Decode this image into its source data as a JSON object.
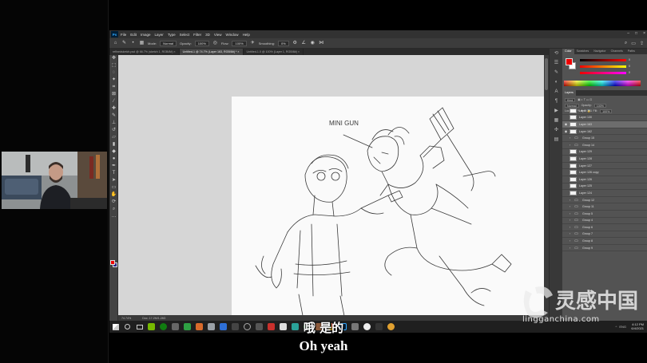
{
  "menu": [
    "File",
    "Edit",
    "Image",
    "Layer",
    "Type",
    "Select",
    "Filter",
    "3D",
    "View",
    "Window",
    "Help"
  ],
  "options": {
    "mode_label": "Mode:",
    "mode_value": "Normal",
    "opacity_label": "Opacity:",
    "opacity_value": "100%",
    "flow_label": "Flow:",
    "flow_value": "100%",
    "smoothing_label": "Smoothing:",
    "smoothing_value": "0%"
  },
  "tabs": [
    {
      "label": "refinedsketch.psd @ 66.7% (sketch 1, RGB/8#) ×",
      "active": false
    },
    {
      "label": "Untitled-1 @ 74.7% (Layer 163, RGB/8#) * ×",
      "active": true
    },
    {
      "label": "Untitled-1.0 @ 100% (Layer 1, RGB/8#) ×",
      "active": false
    }
  ],
  "canvas": {
    "sketch_text": "MINI GUN",
    "status_zoom": "74.74%",
    "status_doc": "Doc: 17.2M/1.28G"
  },
  "color_panel": {
    "tabs": [
      "Color",
      "Swatches",
      "Navigator",
      "Channels",
      "Paths"
    ],
    "values": [
      "0",
      "0",
      "0"
    ],
    "fg": "#ee0000",
    "bg": "#ffffff"
  },
  "layers_panel": {
    "tabs": [
      "Layers"
    ],
    "kind_label": "Kind",
    "blend_mode": "Normal",
    "opacity_label": "Opacity:",
    "opacity_value": "100%",
    "lock_label": "Lock:",
    "fill_label": "Fill:",
    "fill_value": "100%",
    "items": [
      {
        "name": "Layer 161",
        "type": "layer",
        "visible": false,
        "selected": false
      },
      {
        "name": "Layer 130",
        "type": "layer",
        "visible": false,
        "selected": false
      },
      {
        "name": "Layer 163",
        "type": "layer",
        "visible": true,
        "selected": true
      },
      {
        "name": "Layer 162",
        "type": "layer",
        "visible": true,
        "selected": false
      },
      {
        "name": "Group 15",
        "type": "group",
        "visible": false,
        "selected": false
      },
      {
        "name": "Group 14",
        "type": "group",
        "visible": false,
        "selected": false
      },
      {
        "name": "Layer 129",
        "type": "layer",
        "visible": false,
        "selected": false
      },
      {
        "name": "Layer 128",
        "type": "layer",
        "visible": false,
        "selected": false
      },
      {
        "name": "Layer 127",
        "type": "layer",
        "visible": false,
        "selected": false
      },
      {
        "name": "Layer 126 copy",
        "type": "layer",
        "visible": false,
        "selected": false
      },
      {
        "name": "Layer 126",
        "type": "layer",
        "visible": false,
        "selected": false
      },
      {
        "name": "Layer 125",
        "type": "layer",
        "visible": false,
        "selected": false
      },
      {
        "name": "Layer 124",
        "type": "layer",
        "visible": false,
        "selected": false
      },
      {
        "name": "Group 12",
        "type": "group",
        "visible": false,
        "selected": false
      },
      {
        "name": "Group 11",
        "type": "group",
        "visible": false,
        "selected": false
      },
      {
        "name": "Group 5",
        "type": "group",
        "visible": false,
        "selected": false
      },
      {
        "name": "Group 4",
        "type": "group",
        "visible": false,
        "selected": false
      },
      {
        "name": "Group 6",
        "type": "group",
        "visible": false,
        "selected": false
      },
      {
        "name": "Group 7",
        "type": "group",
        "visible": false,
        "selected": false
      },
      {
        "name": "Group 8",
        "type": "group",
        "visible": false,
        "selected": false
      },
      {
        "name": "Group 9",
        "type": "group",
        "visible": false,
        "selected": false
      }
    ]
  },
  "taskbar": {
    "time": "4:12 PM",
    "date": "6/4/2021",
    "tray": "ENG"
  },
  "subtitle": {
    "chinese": "哦 是的",
    "english": "Oh yeah"
  },
  "watermark": {
    "chinese": "灵感中国",
    "url": "lingganchina.com"
  }
}
